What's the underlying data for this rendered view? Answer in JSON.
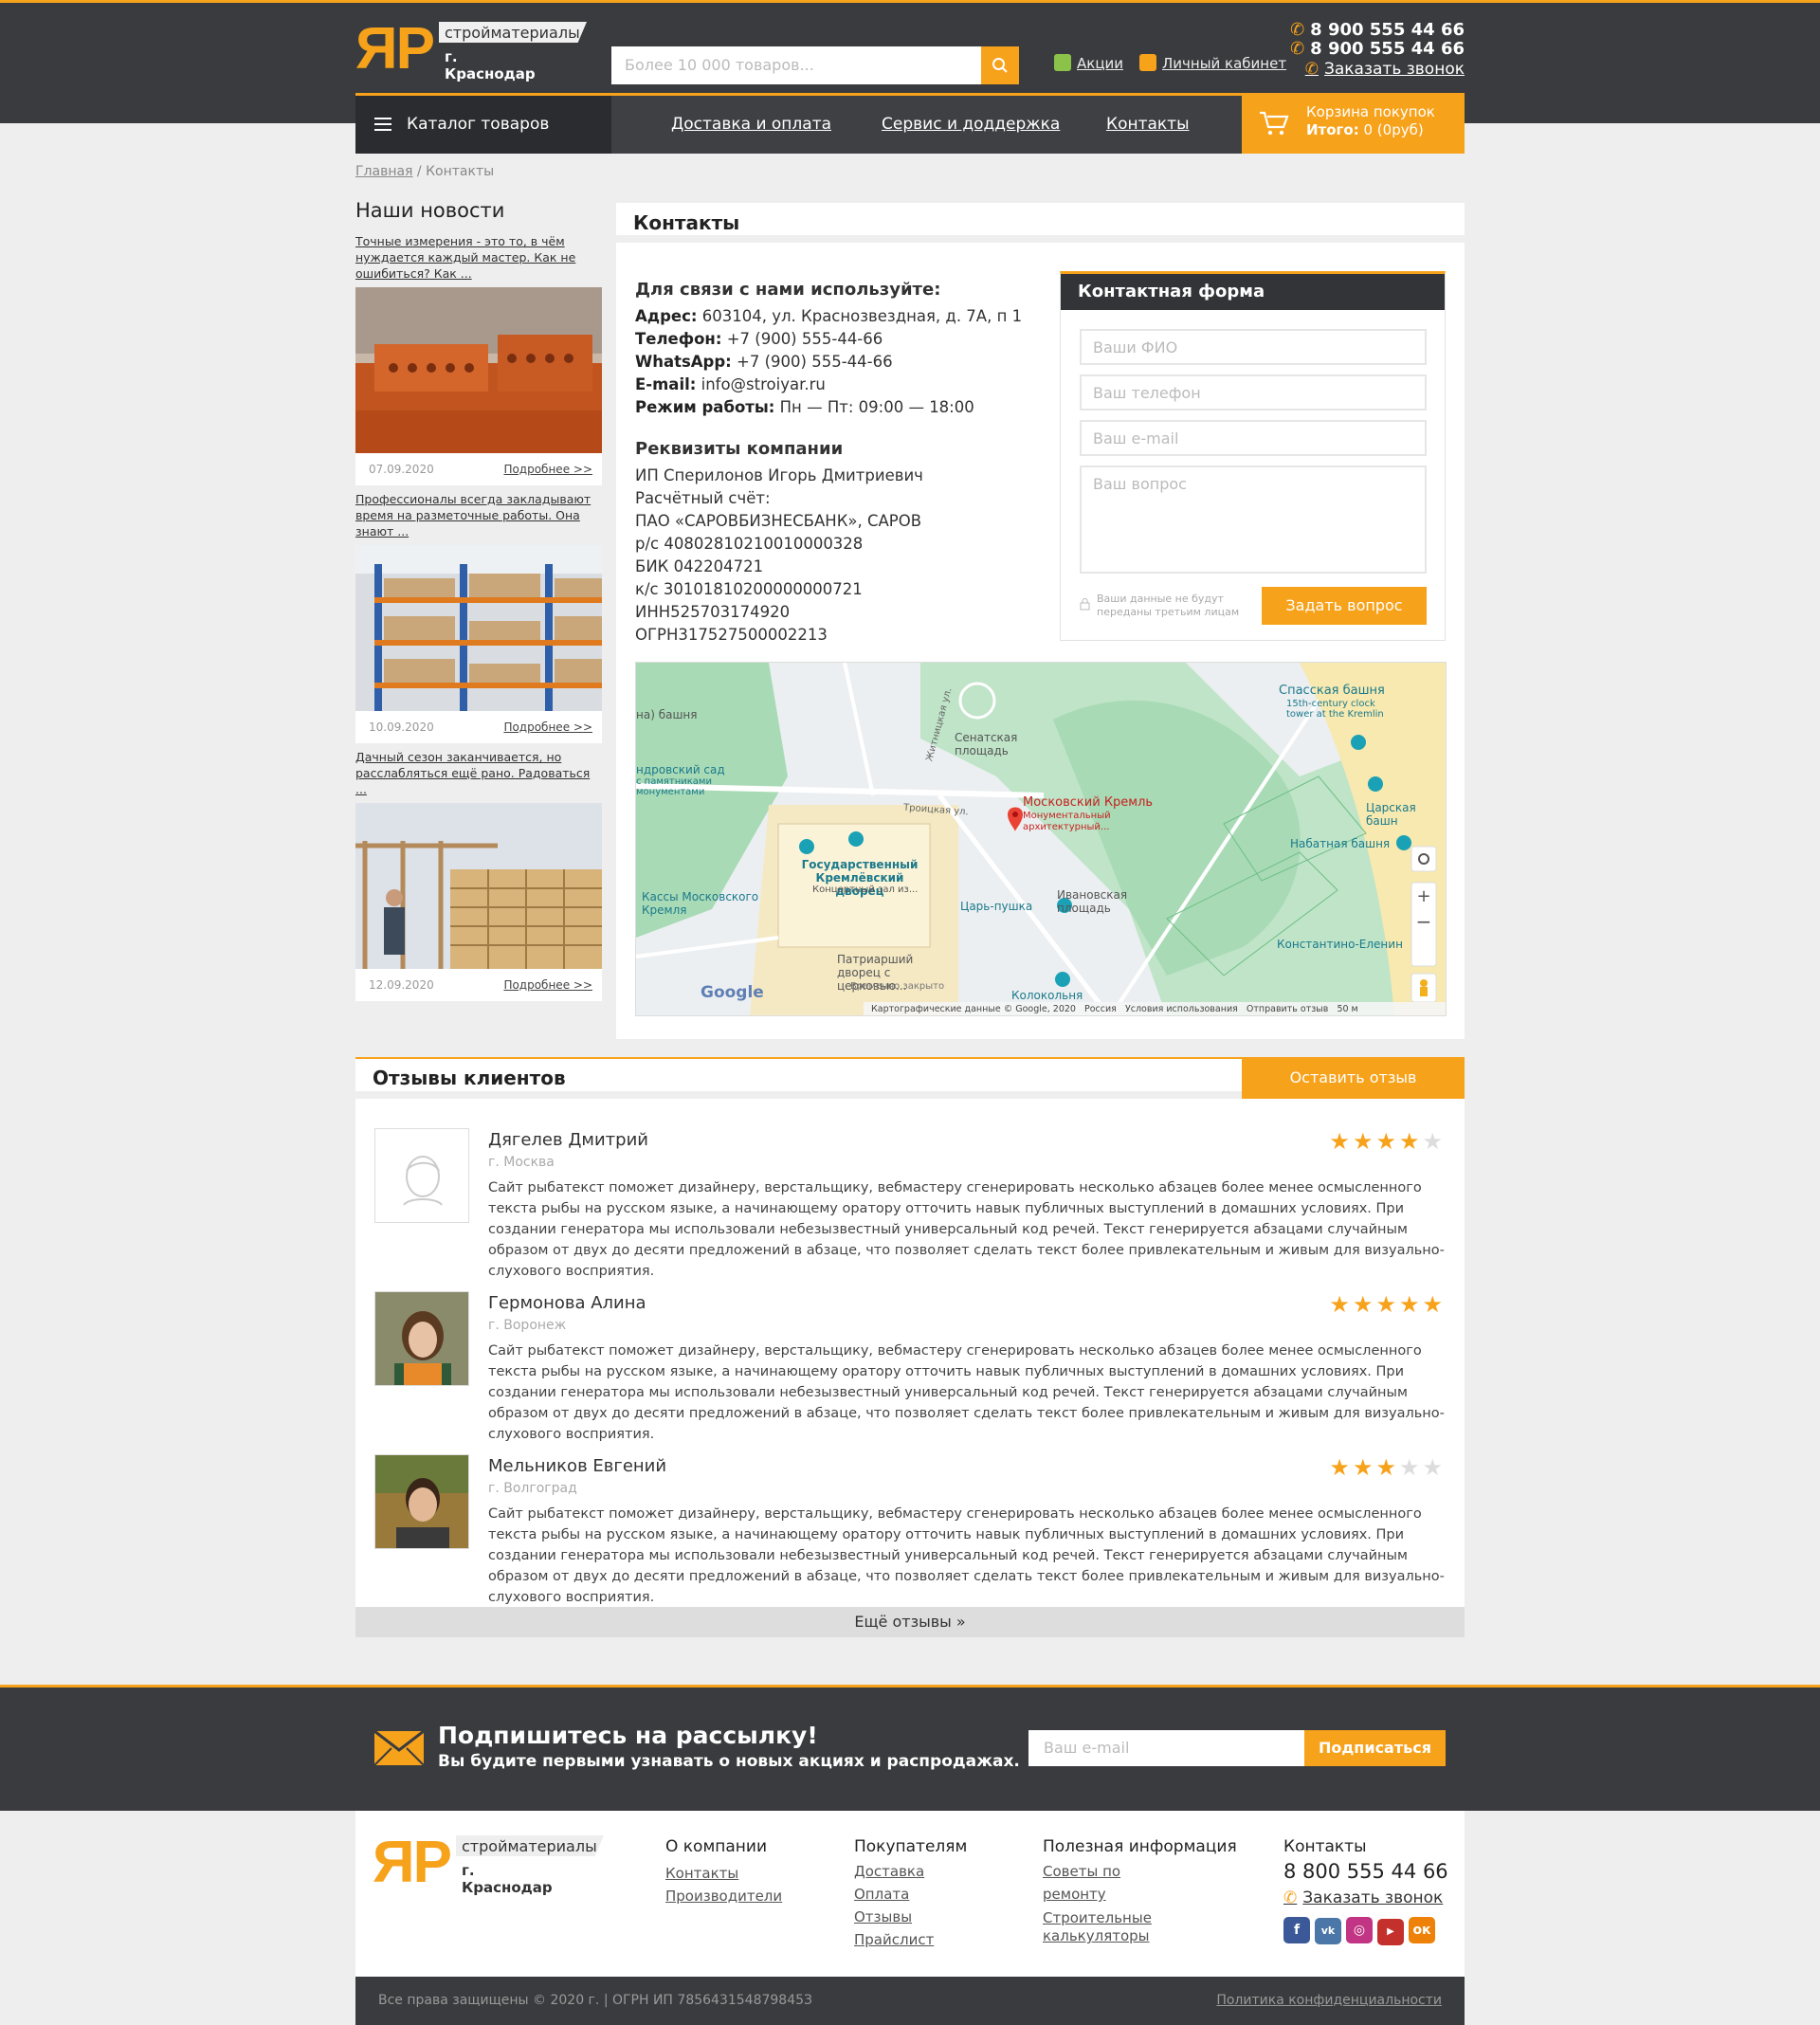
{
  "header": {
    "logo_mark": "ЯР",
    "logo_tagline": "стройматериалы",
    "logo_city": "г. Краснодар",
    "search_placeholder": "Более 10 000 товаров...",
    "promo_link": "Акции",
    "account_link": "Личный кабинет",
    "phone_1": "8 900 555 44 66",
    "phone_2": "8 900 555 44 66",
    "callback": "Заказать звонок"
  },
  "nav": {
    "catalog": "Каталог товаров",
    "items": [
      "Доставка и оплата",
      "Сервис и доддержка",
      "Контакты"
    ],
    "cart_title": "Корзина покупок",
    "cart_total_label": "Итого:",
    "cart_total_value": "0 (0руб)"
  },
  "breadcrumb": {
    "home": "Главная",
    "sep": " / ",
    "current": "Контакты"
  },
  "news": {
    "title": "Наши новости",
    "items": [
      {
        "title": "Точные измерения - это то, в чём нуждается каждый мастер. Как не ошибиться? Как ...",
        "date": "07.09.2020",
        "more": "Подробнее >>"
      },
      {
        "title": "Профессионалы всегда закладывают время на разметочные работы. Она знают ...",
        "date": "10.09.2020",
        "more": "Подробнее >>"
      },
      {
        "title": "Дачный сезон заканчивается, но расслабляться ещё рано. Радоваться ...",
        "date": "12.09.2020",
        "more": "Подробнее >>"
      }
    ]
  },
  "contacts": {
    "title": "Контакты",
    "intro": "Для связи с нами используйте:",
    "address_label": "Адрес:",
    "address": "603104, ул. Краснозвездная, д. 7А, п 1",
    "phone_label": "Телефон:",
    "phone": "+7 (900) 555-44-66",
    "whatsapp_label": "WhatsApp:",
    "whatsapp": "+7 (900) 555-44-66",
    "email_label": "E-mail:",
    "email": "info@stroiyar.ru",
    "hours_label": "Режим работы:",
    "hours": "Пн — Пт: 09:00 — 18:00",
    "req_title": "Реквизиты компании",
    "req_lines": [
      "ИП Сперилонов Игорь Дмитриевич",
      "Расчётный счёт:",
      "ПАО «САРОВБИЗНЕСБАНК», САРОВ",
      "р/с 40802810210010000328",
      "БИК 042204721",
      "к/с 30101810200000000721",
      "ИНН525703174920",
      "ОГРН317527500002213"
    ]
  },
  "form": {
    "title": "Контактная форма",
    "name_ph": "Ваши ФИО",
    "phone_ph": "Ваш телефон",
    "email_ph": "Ваш e-mail",
    "question_ph": "Ваш вопрос",
    "privacy": "Ваши данные не будут переданы третьим лицам",
    "submit": "Задать вопрос"
  },
  "map": {
    "labels": [
      "Спасская башня",
      "15th-century clock tower at the Kremlin",
      "Сенатская площадь",
      "Московский Кремль",
      "Монументальный архитектурный...",
      "Государственный Кремлёвский дворец",
      "Концертный зал из...",
      "Царская башн",
      "Набатная башня",
      "Кассы Московского Кремля",
      "Царь-пушка",
      "Ивановская площадь",
      "Патриарший дворец с церковью...",
      "Временно закрыто",
      "Колокольня",
      "Константино-Еленин",
      "Троицкая ул.",
      "Житницкая ул.",
      "ндровский сад",
      "с памятниками монументами",
      "на) башня",
      "Google"
    ],
    "attribution": "Картографические данные © Google, 2020   Россия   Условия использования   Отправить отзыв   50 м"
  },
  "reviews": {
    "title": "Отзывы клиентов",
    "leave": "Оставить отзыв",
    "more": "Ещё отзывы",
    "text": "Сайт рыбатекст поможет дизайнеру, верстальщику, вебмастеру сгенерировать несколько абзацев более менее осмысленного текста рыбы на русском языке, а начинающему оратору отточить навык публичных выступлений в домашних условиях. При создании генератора мы использовали небезызвестный универсальный код речей. Текст генерируется абзацами случайным образом от двух до десяти предложений в абзаце, что позволяет сделать текст более привлекательным и живым для визуально-слухового восприятия.",
    "items": [
      {
        "name": "Дягелев Дмитрий",
        "city": "г. Москва",
        "rating": 4
      },
      {
        "name": "Гермонова Алина",
        "city": "г. Воронеж",
        "rating": 5
      },
      {
        "name": "Мельников Евгений",
        "city": "г. Волгоград",
        "rating": 3
      }
    ]
  },
  "subscribe": {
    "title": "Подпишитесь на рассылку!",
    "subtitle": "Вы будите первыми узнавать о новых акциях и распродажах.",
    "placeholder": "Ваш e-mail",
    "button": "Подписаться"
  },
  "footer": {
    "col1_title": "О компании",
    "col1": [
      "Контакты",
      "Производители"
    ],
    "col2_title": "Покупателям",
    "col2": [
      "Доставка",
      "Оплата",
      "Отзывы",
      "Прайслист"
    ],
    "col3_title": "Полезная информация",
    "col3": [
      "Советы по ремонту",
      "Строительные калькуляторы"
    ],
    "col4_title": "Контакты",
    "phone": "8 800 555 44 66",
    "callback": "Заказать звонок",
    "copyright": "Все права защищены © 2020 г. | ОГРН ИП 785643154879845З",
    "privacy": "Политика конфиденциальности"
  },
  "colors": {
    "accent": "#f7a21b",
    "dark": "#3a3b3e",
    "star_off": "#dddddd"
  }
}
